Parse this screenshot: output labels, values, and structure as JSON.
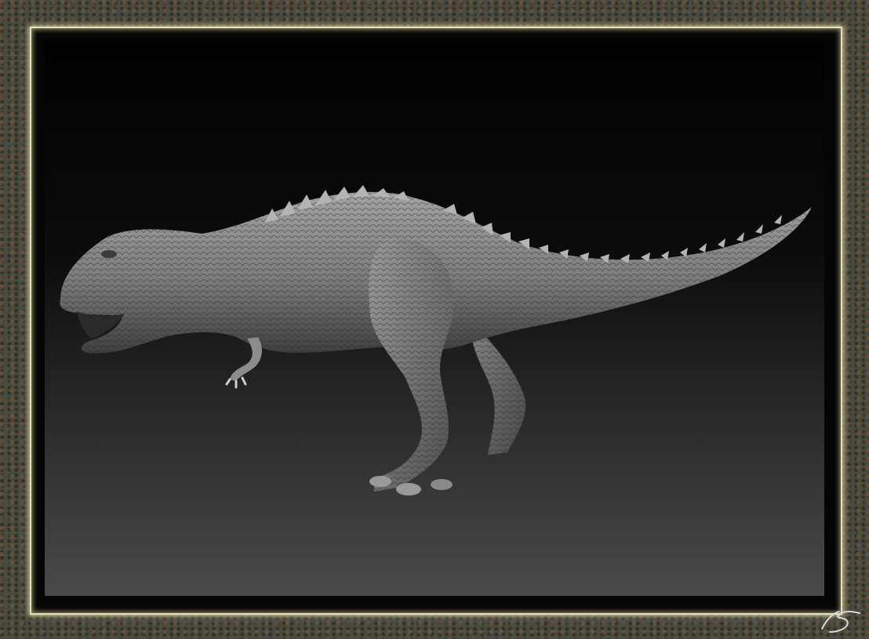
{
  "image": {
    "subject": "dinosaur-sculpture",
    "frame_texture": "stone-texture",
    "colors": {
      "frame": "#4b4a3f",
      "border_glow": "#e8e2b0",
      "viewport_top": "#000000",
      "viewport_bottom": "#4a4a4a",
      "sculpt": "#8a8a8a"
    }
  }
}
